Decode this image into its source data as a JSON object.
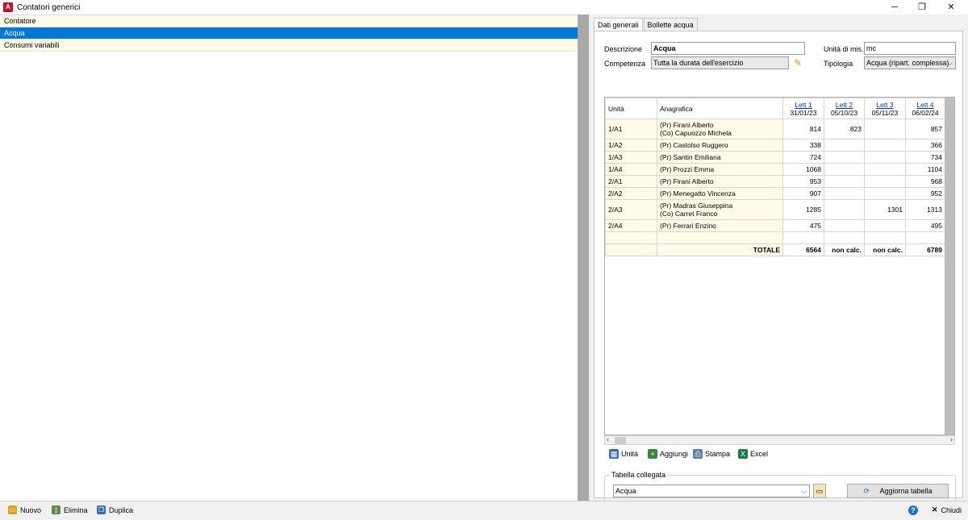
{
  "window": {
    "title": "Contatori generici",
    "logo": "A",
    "minimize": "─",
    "restore": "❐",
    "close": "✕"
  },
  "list": {
    "header": "Contatore",
    "items": [
      "Acqua",
      "Consumi variabili"
    ]
  },
  "tabs": [
    "Dati generali",
    "Bollette acqua"
  ],
  "form": {
    "descrizione_label": "Descrizione",
    "descrizione_value": "Acqua",
    "competenza_label": "Competenza",
    "competenza_value": "Tutta la durata dell'esercizio",
    "unita_label": "Unità di mis.",
    "unita_value": "mc",
    "tipologia_label": "Tipologia",
    "tipologia_value": "Acqua (ripart. complessa)"
  },
  "grid": {
    "col_unita": "Unità",
    "col_anagrafica": "Anagrafica",
    "readings": [
      {
        "label": "Lett 1",
        "date": "31/01/23"
      },
      {
        "label": "Lett 2",
        "date": "05/10/23"
      },
      {
        "label": "Lett 3",
        "date": "05/11/23"
      },
      {
        "label": "Lett 4",
        "date": "06/02/24"
      }
    ],
    "rows": [
      {
        "unit": "1/A1",
        "names": [
          "(Pr) Firani Alberto",
          "(Co) Capuozzo Michela"
        ],
        "vals": [
          "814",
          "823",
          "",
          "857"
        ]
      },
      {
        "unit": "1/A2",
        "names": [
          "(Pr) Castolso Ruggero"
        ],
        "vals": [
          "338",
          "",
          "",
          "366"
        ]
      },
      {
        "unit": "1/A3",
        "names": [
          "(Pr) Santin Emiliana"
        ],
        "vals": [
          "724",
          "",
          "",
          "734"
        ]
      },
      {
        "unit": "1/A4",
        "names": [
          "(Pr) Prozzi Emma"
        ],
        "vals": [
          "1068",
          "",
          "",
          "1104"
        ]
      },
      {
        "unit": "2/A1",
        "names": [
          "(Pr) Firani Alberto"
        ],
        "vals": [
          "953",
          "",
          "",
          "968"
        ]
      },
      {
        "unit": "2/A2",
        "names": [
          "(Pr) Menegatto Vincenza"
        ],
        "vals": [
          "907",
          "",
          "",
          "952"
        ]
      },
      {
        "unit": "2/A3",
        "names": [
          "(Pr) Madras Giuseppina",
          "(Co) Carret Franco"
        ],
        "vals": [
          "1285",
          "",
          "1301",
          "1313"
        ]
      },
      {
        "unit": "2/A4",
        "names": [
          "(Pr) Ferrari Enzino"
        ],
        "vals": [
          "475",
          "",
          "",
          "495"
        ]
      }
    ],
    "total_label": "TOTALE",
    "totals": [
      "6564",
      "non calc.",
      "non calc.",
      "6789"
    ]
  },
  "toolbar": {
    "unita": "Unità",
    "aggiungi": "Aggiungi",
    "stampa": "Stampa",
    "excel": "Excel"
  },
  "linked": {
    "title": "Tabella collegata",
    "value": "Acqua",
    "refresh": "Aggiorna tabella"
  },
  "bottom": {
    "nuovo": "Nuovo",
    "elimina": "Elimina",
    "duplica": "Duplica",
    "chiudi": "Chiudi",
    "help": "?"
  },
  "colors": {
    "selection": "#0078d7",
    "highlight": "#fffbe6",
    "link": "#0033cc"
  }
}
